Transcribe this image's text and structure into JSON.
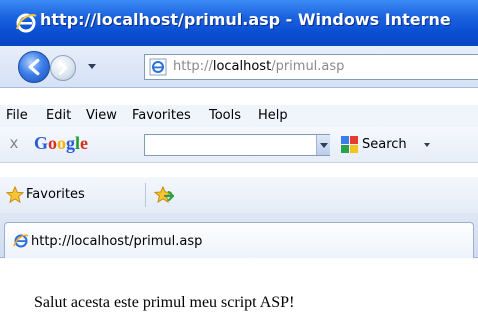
{
  "window": {
    "title": "http://localhost/primul.asp - Windows Interne"
  },
  "address": {
    "prefix": "http://",
    "host": "localhost",
    "path": "/primul.asp"
  },
  "menu": {
    "items": [
      "File",
      "Edit",
      "View",
      "Favorites",
      "Tools",
      "Help"
    ]
  },
  "google_toolbar": {
    "close": "x",
    "logo": [
      "G",
      "o",
      "o",
      "g",
      "l",
      "e"
    ],
    "search_label": "Search",
    "search_value": ""
  },
  "favorites": {
    "label": "Favorites"
  },
  "tab": {
    "label": "http://localhost/primul.asp"
  },
  "page": {
    "text": "Salut acesta este primul meu script ASP!"
  },
  "colors": {
    "titlebar": "#0a4fd3",
    "google_logo": [
      "#2a5bd7",
      "#d62d20",
      "#f4b400",
      "#2a5bd7",
      "#1a9a3a",
      "#d62d20"
    ]
  }
}
